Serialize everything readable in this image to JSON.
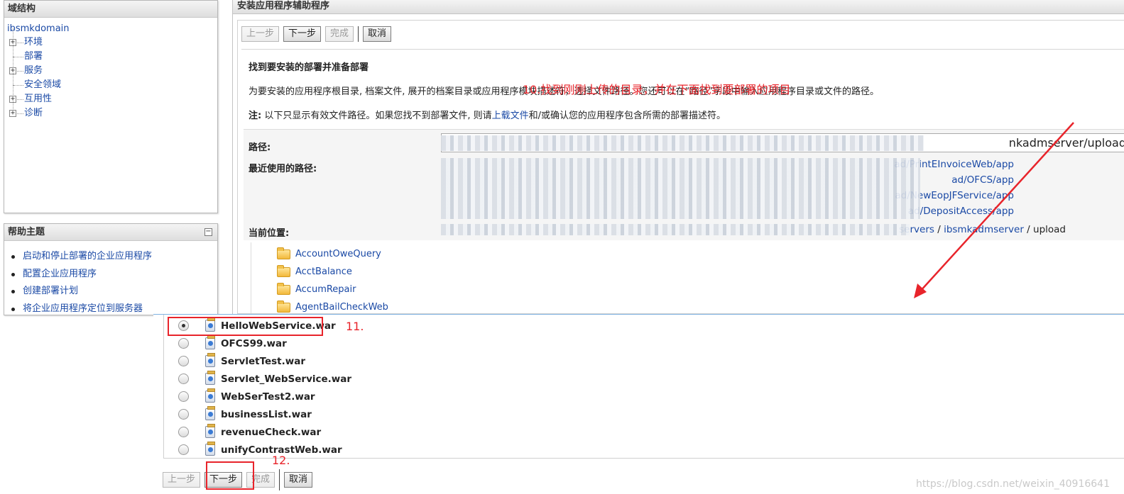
{
  "domain_panel": {
    "title": "域结构",
    "root": "ibsmkdomain",
    "items": [
      {
        "label": "环境",
        "expandable": true
      },
      {
        "label": "部署",
        "expandable": false
      },
      {
        "label": "服务",
        "expandable": true
      },
      {
        "label": "安全领域",
        "expandable": false
      },
      {
        "label": "互用性",
        "expandable": true
      },
      {
        "label": "诊断",
        "expandable": true
      }
    ],
    "expander_symbol": "+"
  },
  "help_panel": {
    "title": "帮助主题",
    "collapse_symbol": "−",
    "items": [
      "启动和停止部署的企业应用程序",
      "配置企业应用程序",
      "创建部署计划",
      "将企业应用程序定位到服务器"
    ]
  },
  "wizard": {
    "title": "安装应用程序辅助程序",
    "buttons": {
      "back": "上一步",
      "next": "下一步",
      "finish": "完成",
      "cancel": "取消"
    },
    "section_title": "找到要安装的部署并准备部署",
    "description": "为要安装的应用程序根目录, 档案文件, 展开的档案目录或应用程序模块描述符，选择文件路径。您还可以在“路径”字段中输入应用程序目录或文件的路径。",
    "note_label": "注:",
    "note_before": " 以下只显示有效文件路径。如果您找不到部署文件, 则请",
    "note_link": "上载文件",
    "note_after": "和/或确认您的应用程序包含所需的部署描述符。",
    "path_label": "路径:",
    "path_value": "nkadmserver/upload",
    "recent_label": "最近使用的路径:",
    "recent_paths": [
      "ad/PrintEInvoiceWeb/app",
      "ad/OFCS/app",
      "ad/NewEopJFService/app",
      "ad/DepositAccess/app"
    ],
    "current_label": "当前位置:",
    "current_location": {
      "servers": "servers",
      "sep": " / ",
      "server": "ibsmkadmserver",
      "folder": "upload"
    },
    "folders": [
      "AccountOweQuery",
      "AcctBalance",
      "AccumRepair",
      "AgentBailCheckWeb"
    ]
  },
  "war_files": [
    {
      "name": "HelloWebService.war",
      "selected": true
    },
    {
      "name": "OFCS99.war",
      "selected": false
    },
    {
      "name": "ServletTest.war",
      "selected": false
    },
    {
      "name": "Servlet_WebService.war",
      "selected": false
    },
    {
      "name": "WebSerTest2.war",
      "selected": false
    },
    {
      "name": "businessList.war",
      "selected": false
    },
    {
      "name": "revenueCheck.war",
      "selected": false
    },
    {
      "name": "unifyContrastWeb.war",
      "selected": false
    }
  ],
  "annotations": {
    "step10": "10.找到刚刚上传的目录，并在下面找到要部署的项目",
    "step11": "11.",
    "step12": "12.",
    "color": "#e8242b"
  },
  "watermark": "https://blog.csdn.net/weixin_40916641"
}
